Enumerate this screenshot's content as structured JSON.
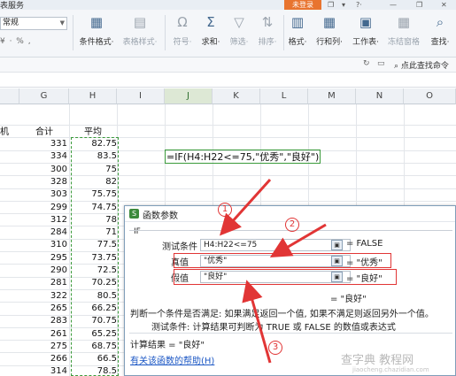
{
  "titlebar": {
    "app_fragment": "表服务",
    "badge": "未登录",
    "window_icons": [
      "❐",
      "▾",
      "?·",
      "—",
      "❐",
      "✕"
    ]
  },
  "ribbon": {
    "font_value": "常规",
    "number_format": "¥ · % ,",
    "buttons": [
      {
        "icon": "▦",
        "label": "条件格式·"
      },
      {
        "icon": "▤",
        "label": "表格样式·"
      },
      {
        "icon": "Ω",
        "label": "符号·"
      },
      {
        "icon": "Σ",
        "label": "求和·"
      },
      {
        "icon": "▽",
        "label": "筛选·"
      },
      {
        "icon": "⇅",
        "label": "排序·"
      },
      {
        "icon": "▥",
        "label": "格式·"
      },
      {
        "icon": "▦",
        "label": "行和列·"
      },
      {
        "icon": "▣",
        "label": "工作表·"
      },
      {
        "icon": "▦",
        "label": "冻结窗格"
      },
      {
        "icon": "⌕",
        "label": "查找·"
      }
    ]
  },
  "subbar": {
    "search_label": "点此查找命令"
  },
  "columns": [
    "G",
    "H",
    "I",
    "J",
    "K",
    "L",
    "M",
    "N",
    "O"
  ],
  "header_row": {
    "left_fragment": "机",
    "g": "合计",
    "h": "平均"
  },
  "rows": [
    {
      "g": "331",
      "h": "82.75"
    },
    {
      "g": "334",
      "h": "83.5"
    },
    {
      "g": "300",
      "h": "75"
    },
    {
      "g": "328",
      "h": "82"
    },
    {
      "g": "303",
      "h": "75.75"
    },
    {
      "g": "299",
      "h": "74.75"
    },
    {
      "g": "312",
      "h": "78"
    },
    {
      "g": "284",
      "h": "71"
    },
    {
      "g": "310",
      "h": "77.5"
    },
    {
      "g": "295",
      "h": "73.75"
    },
    {
      "g": "290",
      "h": "72.5"
    },
    {
      "g": "281",
      "h": "70.25"
    },
    {
      "g": "322",
      "h": "80.5"
    },
    {
      "g": "265",
      "h": "66.25"
    },
    {
      "g": "283",
      "h": "70.75"
    },
    {
      "g": "261",
      "h": "65.25"
    },
    {
      "g": "275",
      "h": "68.75"
    },
    {
      "g": "266",
      "h": "66.5"
    },
    {
      "g": "314",
      "h": "78.5"
    }
  ],
  "formula": "=IF(H4:H22<=75,\"优秀\",\"良好\")",
  "dialog": {
    "title": "函数参数",
    "function_name": "IF",
    "params": [
      {
        "label": "测试条件",
        "value": "H4:H22<=75",
        "result": "= FALSE"
      },
      {
        "label": "真值",
        "value": "\"优秀\"",
        "result": "= \"优秀\""
      },
      {
        "label": "假值",
        "value": "\"良好\"",
        "result": "= \"良好\""
      }
    ],
    "overall_result": "= \"良好\"",
    "description": "判断一个条件是否满足: 如果满足返回一个值, 如果不满足则返回另外一个值。",
    "param_help": "测试条件:  计算结果可判断为 TRUE 或 FALSE 的数值或表达式",
    "calc_result": "计算结果 = \"良好\"",
    "help_link": "有关该函数的帮助(H)"
  },
  "annotations": [
    "1",
    "2",
    "3"
  ],
  "watermark": "查字典 教程网",
  "watermark_url": "jiaocheng.chazidian.com",
  "colors": {
    "accent_green": "#3a9a3a",
    "annotation_red": "#e13535",
    "badge_orange": "#e8742f"
  }
}
